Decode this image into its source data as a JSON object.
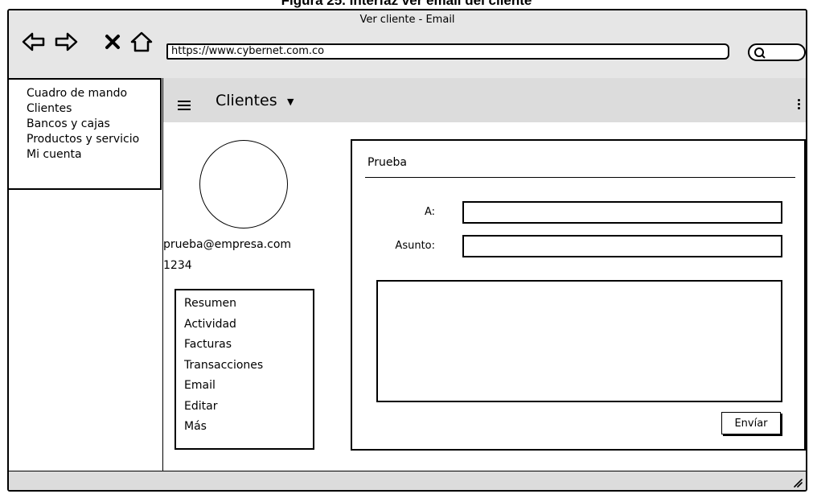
{
  "caption": "Figura 25. Interfaz ver email del cliente",
  "window": {
    "title": "Ver cliente - Email",
    "url": "https://www.cybernet.com.co"
  },
  "icons": {
    "back": "arrow-left-icon",
    "forward": "arrow-right-icon",
    "stop": "close-icon",
    "home": "home-icon",
    "search": "search-icon",
    "menu": "hamburger-icon",
    "more": "kebab-icon",
    "dropdown": "caret-down-icon"
  },
  "sidebar": {
    "items": [
      {
        "label": "Cuadro de mando"
      },
      {
        "label": "Clientes"
      },
      {
        "label": "Bancos y cajas"
      },
      {
        "label": "Productos y servicio"
      },
      {
        "label": "Mi cuenta"
      }
    ]
  },
  "appbar": {
    "title": "Clientes"
  },
  "client": {
    "email": "prueba@empresa.com",
    "number": "1234"
  },
  "submenu": {
    "items": [
      {
        "label": "Resumen"
      },
      {
        "label": "Actividad"
      },
      {
        "label": "Facturas"
      },
      {
        "label": "Transacciones"
      },
      {
        "label": "Email"
      },
      {
        "label": "Editar"
      },
      {
        "label": "Más"
      }
    ]
  },
  "email_form": {
    "title": "Prueba",
    "to_label": "A:",
    "to_value": "",
    "subject_label": "Asunto:",
    "subject_value": "",
    "body_value": "",
    "send_label": "Envíar"
  }
}
